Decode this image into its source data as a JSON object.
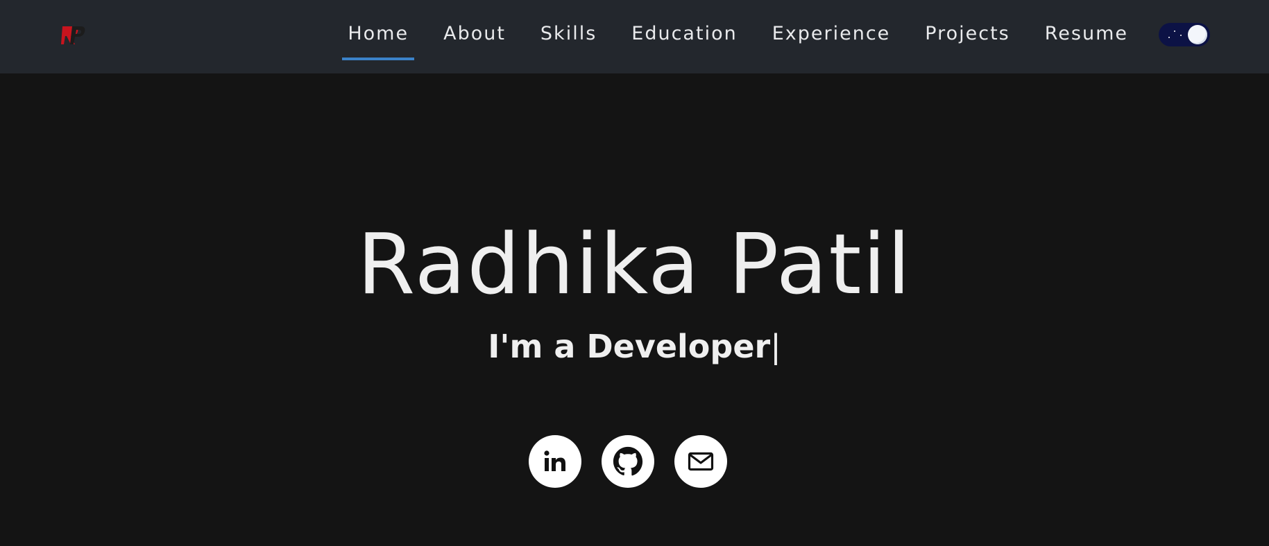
{
  "nav": {
    "logo_text": "RP",
    "links": [
      {
        "label": "Home",
        "active": true
      },
      {
        "label": "About"
      },
      {
        "label": "Skills"
      },
      {
        "label": "Education"
      },
      {
        "label": "Experience"
      },
      {
        "label": "Projects"
      },
      {
        "label": "Resume"
      }
    ],
    "theme_toggle": {
      "mode": "dark",
      "icon": "moon-icon"
    }
  },
  "hero": {
    "name": "Radhika Patil",
    "tagline_prefix": "I'm a ",
    "tagline_role": "Developer",
    "cursor": "|"
  },
  "social": [
    {
      "icon": "linkedin-icon",
      "label": "in"
    },
    {
      "icon": "github-icon"
    },
    {
      "icon": "mail-icon"
    }
  ],
  "colors": {
    "nav_bg": "#23272d",
    "page_bg": "#141414",
    "accent": "#3b82c9",
    "logo_red": "#c8141e",
    "toggle_bg": "#0c1245"
  }
}
